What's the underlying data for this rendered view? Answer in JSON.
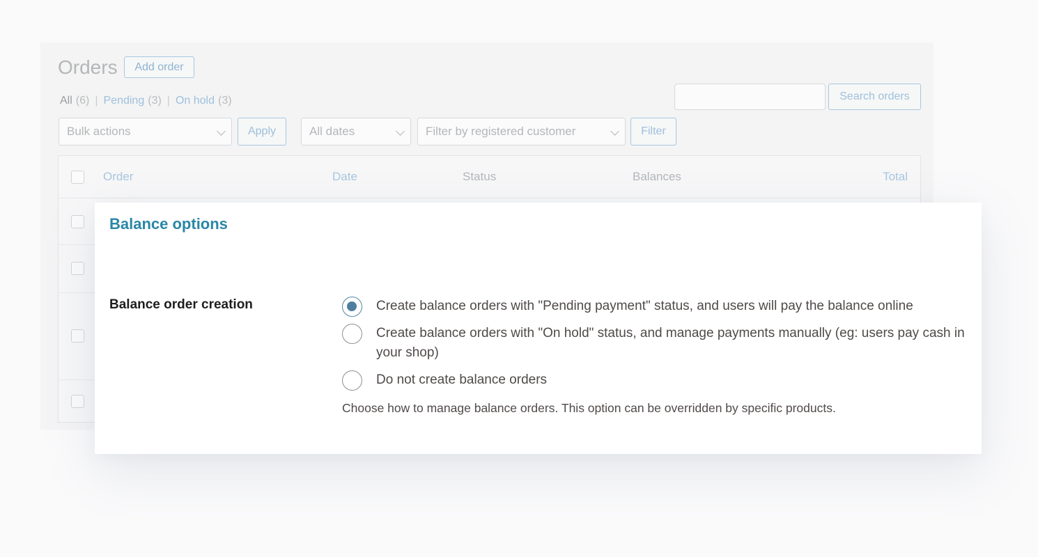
{
  "orders_page": {
    "title": "Orders",
    "add_order_label": "Add order",
    "filters": {
      "all_label": "All",
      "all_count": "(6)",
      "pending_label": "Pending",
      "pending_count": "(3)",
      "on_hold_label": "On hold",
      "on_hold_count": "(3)",
      "separator": "|"
    },
    "search": {
      "value": "",
      "button_label": "Search orders"
    },
    "bulk_actions": {
      "selected": "Bulk actions",
      "apply_label": "Apply"
    },
    "date_filter": {
      "selected": "All dates"
    },
    "customer_filter": {
      "placeholder": "Filter by registered customer"
    },
    "filter_button_label": "Filter",
    "table": {
      "columns": [
        "Order",
        "Date",
        "Status",
        "Balances",
        "Total"
      ]
    }
  },
  "balance_options": {
    "title": "Balance options",
    "field_label": "Balance order creation",
    "options": [
      {
        "label": "Create balance orders with \"Pending payment\" status, and users will pay the balance online",
        "checked": true
      },
      {
        "label": "Create balance orders with \"On hold\" status, and manage payments manually (eg: users pay cash in your shop)",
        "checked": false
      },
      {
        "label": "Do not create balance orders",
        "checked": false
      }
    ],
    "description": "Choose how to manage balance orders. This option can be overridden by specific products."
  },
  "colors": {
    "accent": "#2b86a6",
    "radio_checked": "#4f7fa0",
    "link_faded": "#9ec0dc"
  }
}
